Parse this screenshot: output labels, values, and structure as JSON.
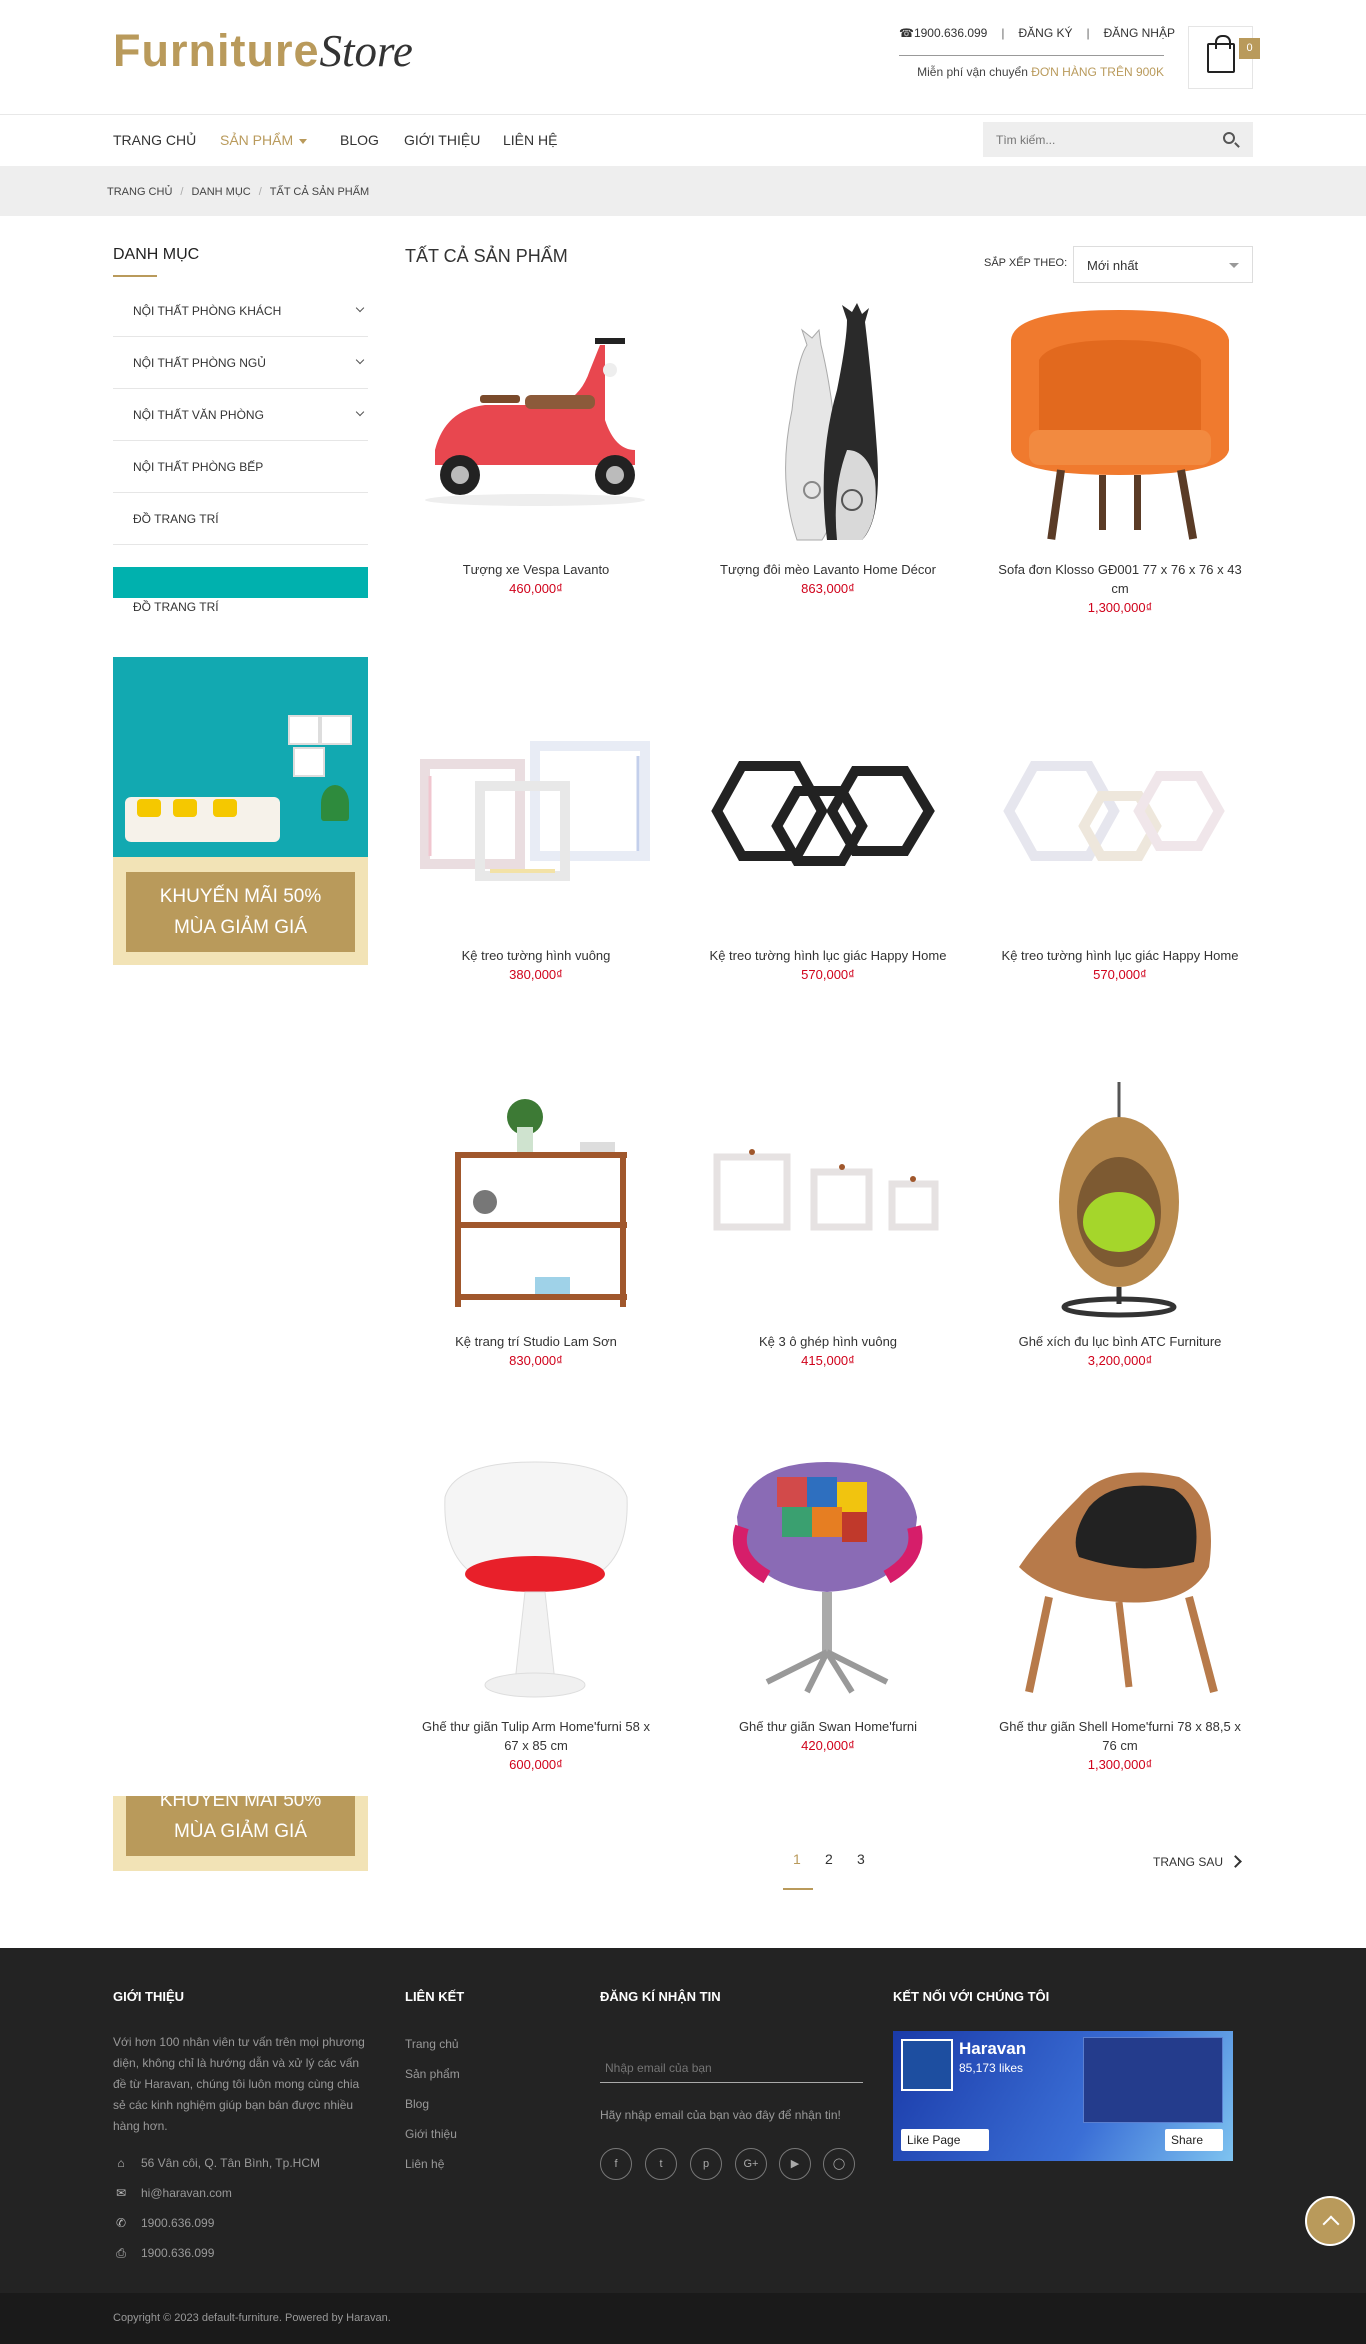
{
  "header": {
    "logo_part1": "Furniture",
    "logo_part2": "Store",
    "phone": "☎1900.636.099",
    "register": "ĐĂNG KÝ",
    "login": "ĐĂNG NHẬP",
    "shipping_text": "Miễn phí vận chuyển",
    "shipping_highlight": "ĐƠN HÀNG TRÊN 900K",
    "cart_count": "0",
    "accent_color": "#b99a5b"
  },
  "nav": {
    "items": [
      {
        "label": "TRANG CHỦ"
      },
      {
        "label": "SẢN PHẨM"
      },
      {
        "label": "BLOG"
      },
      {
        "label": "GIỚI THIỆU"
      },
      {
        "label": "LIÊN HỆ"
      }
    ],
    "search_placeholder": "Tìm kiếm..."
  },
  "breadcrumb": [
    "TRANG CHỦ",
    "DANH MỤC",
    "TẤT CẢ SẢN PHẨM"
  ],
  "sidebar": {
    "title": "DANH MỤC",
    "categories": [
      {
        "label": "NỘI THẤT PHÒNG KHÁCH"
      },
      {
        "label": "NỘI THẤT PHÒNG NGỦ"
      },
      {
        "label": "NỘI THẤT VĂN PHÒNG"
      },
      {
        "label": "NỘI THẤT PHÒNG BẾP"
      },
      {
        "label": "ĐỒ TRANG TRÍ"
      }
    ],
    "extra_item": "ĐỒ TRANG TRÍ",
    "promo_line1": "KHUYẾN MÃI 50%",
    "promo_line2": "MÙA GIẢM GIÁ"
  },
  "main": {
    "title": "TẤT CẢ SẢN PHẨM",
    "sort_label": "SẮP XẾP THEO:",
    "sort_value": "Mới nhất"
  },
  "products": [
    {
      "name": "Tượng xe Vespa Lavanto",
      "price": "460,000₫",
      "icon": "vespa-image"
    },
    {
      "name": "Tượng đôi mèo Lavanto Home Décor",
      "price": "863,000₫",
      "icon": "cat-figurine-image"
    },
    {
      "name": "Sofa đơn Klosso GĐ001 77 x 76 x 76 x 43 cm",
      "price": "1,300,000₫",
      "icon": "armchair-image"
    },
    {
      "name": "Kệ treo tường hình vuông",
      "price": "380,000₫",
      "icon": "square-shelf-image"
    },
    {
      "name": "Kệ treo tường hình lục giác Happy Home",
      "price": "570,000₫",
      "icon": "hexagon-shelf-black-image"
    },
    {
      "name": "Kệ treo tường hình lục giác Happy Home",
      "price": "570,000₫",
      "icon": "hexagon-shelf-white-image"
    },
    {
      "name": "Kệ trang trí Studio Lam Sơn",
      "price": "830,000₫",
      "icon": "wooden-shelf-image"
    },
    {
      "name": "Kệ 3 ô ghép hình vuông",
      "price": "415,000₫",
      "icon": "three-box-shelf-image"
    },
    {
      "name": "Ghế xích đu lục bình ATC Furniture",
      "price": "3,200,000₫",
      "icon": "hanging-chair-image"
    },
    {
      "name": "Ghế thư giãn Tulip Arm Home'furni 58 x 67 x 85 cm",
      "price": "600,000₫",
      "icon": "tulip-chair-image"
    },
    {
      "name": "Ghế thư giãn Swan Home'furni",
      "price": "420,000₫",
      "icon": "swan-chair-image"
    },
    {
      "name": "Ghế thư giãn Shell Home'furni 78 x 88,5 x 76 cm",
      "price": "1,300,000₫",
      "icon": "shell-chair-image"
    }
  ],
  "pagination": {
    "pages": [
      "1",
      "2",
      "3"
    ],
    "current": "1",
    "next_label": "TRANG SAU"
  },
  "footer": {
    "about_title": "GIỚI THIỆU",
    "about_text": "Với hơn 100 nhân viên tư vấn trên mọi phương diện, không chỉ là hướng dẫn và xử lý các vấn đề từ Haravan, chúng tôi luôn mong cùng chia sẻ các kinh nghiệm giúp bạn bán được nhiều hàng hơn.",
    "address": "56 Vân côi, Q. Tân Bình, Tp.HCM",
    "email": "hi@haravan.com",
    "phone": "1900.636.099",
    "fax": "1900.636.099",
    "links_title": "LIÊN KẾT",
    "links": [
      "Trang chủ",
      "Sản phẩm",
      "Blog",
      "Giới thiệu",
      "Liên hệ"
    ],
    "newsletter_title": "ĐĂNG KÍ NHẬN TIN",
    "newsletter_placeholder": "Nhập email của bạn",
    "newsletter_note": "Hãy nhập email của bạn vào đây để nhận tin!",
    "social_title": "KẾT NỐI VỚI CHÚNG TÔI",
    "social_icons": [
      "facebook-icon",
      "twitter-icon",
      "pinterest-icon",
      "google-plus-icon",
      "youtube-icon",
      "instagram-icon"
    ],
    "fb_page_name": "Haravan",
    "fb_likes": "85,173 likes",
    "fb_like_button": "Like Page",
    "fb_share_button": "Share",
    "copyright": "Copyright © 2023 default-furniture. Powered by Haravan."
  }
}
